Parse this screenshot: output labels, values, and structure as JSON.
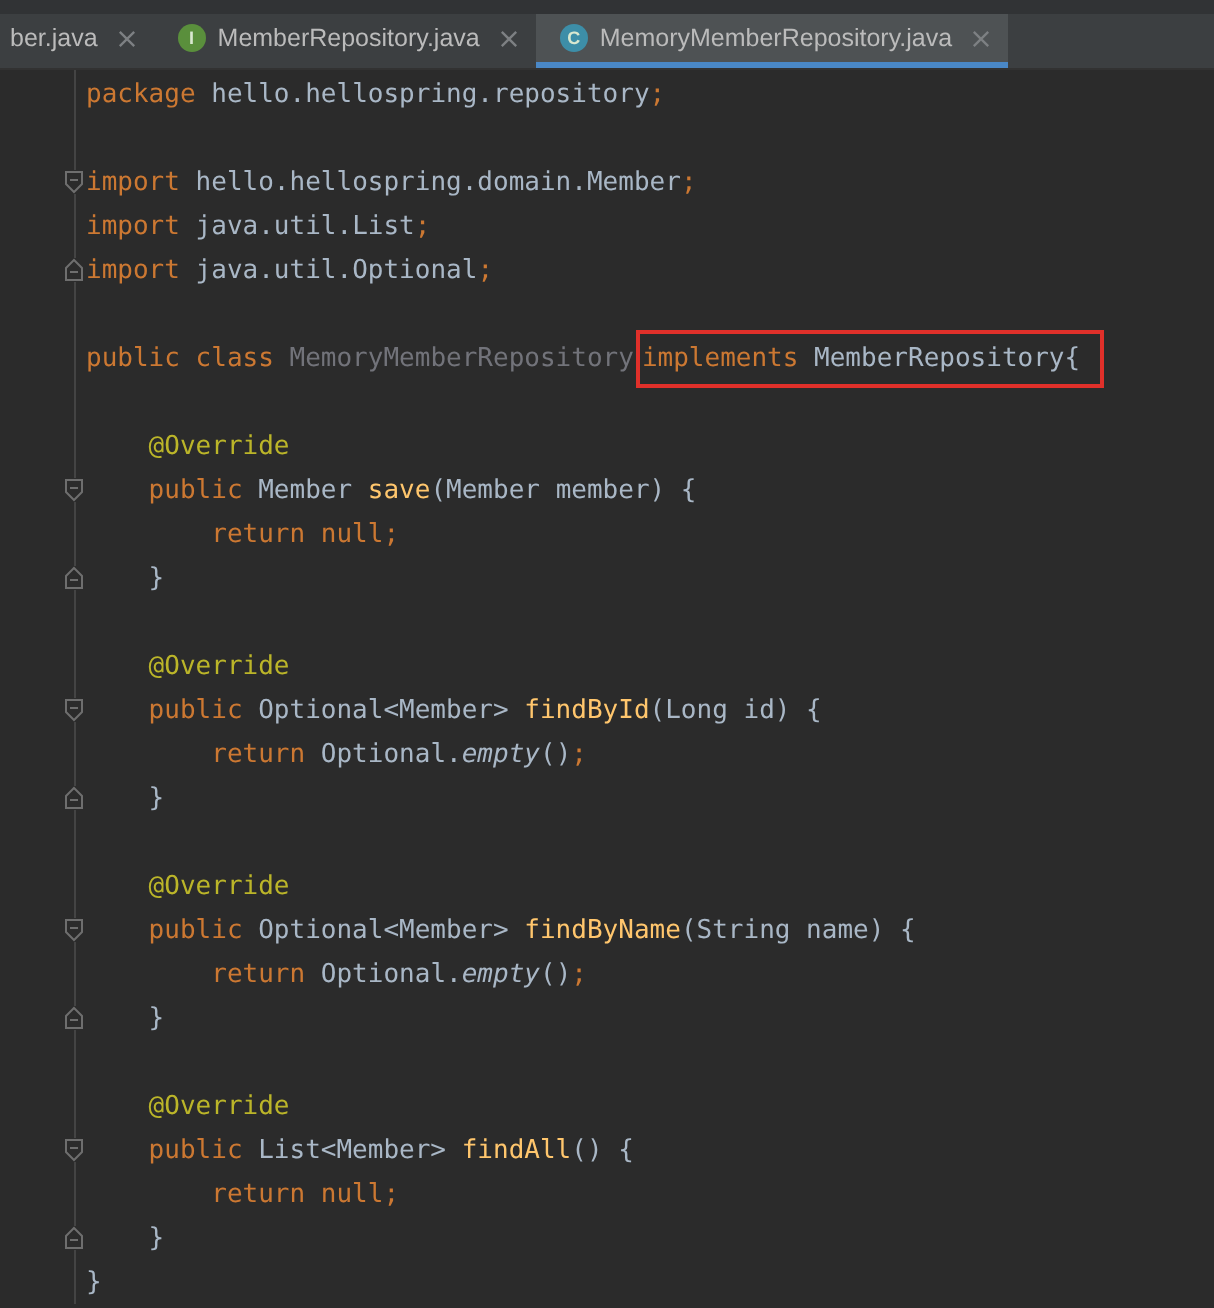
{
  "tabs": [
    {
      "label": "ber.java",
      "selected": false
    },
    {
      "label": "MemberRepository.java",
      "selected": false,
      "icon_letter": "I",
      "color": "#5a8f3c"
    },
    {
      "label": "MemoryMemberRepository.java",
      "selected": true,
      "icon_letter": "C",
      "color": "#3d8ea8"
    }
  ],
  "code_lines": [
    {
      "kind": "plain",
      "tokens": [
        {
          "kind": "keyword",
          "text": "package "
        },
        {
          "kind": "plain",
          "text": "hello.hellospring.repository"
        },
        {
          "kind": "keyword",
          "text": ";"
        }
      ]
    },
    {
      "kind": "blank"
    },
    {
      "kind": "fold_start",
      "tokens": [
        {
          "kind": "keyword",
          "text": "import "
        },
        {
          "kind": "plain",
          "text": "hello.hellospring.domain.Member"
        },
        {
          "kind": "keyword",
          "text": ";"
        }
      ]
    },
    {
      "kind": "plain",
      "tokens": [
        {
          "kind": "keyword",
          "text": "import "
        },
        {
          "kind": "plain",
          "text": "java.util.List"
        },
        {
          "kind": "keyword",
          "text": ";"
        }
      ]
    },
    {
      "kind": "fold_end",
      "tokens": [
        {
          "kind": "keyword",
          "text": "import "
        },
        {
          "kind": "plain",
          "text": "java.util.Optional"
        },
        {
          "kind": "keyword",
          "text": ";"
        }
      ]
    },
    {
      "kind": "blank"
    },
    {
      "kind": "plain",
      "segments": [
        {
          "highlighted": false,
          "tokens": [
            {
              "kind": "keyword",
              "text": "public class "
            },
            {
              "kind": "unused",
              "text": "MemoryMemberRepository"
            }
          ]
        },
        {
          "highlighted": true,
          "tokens": [
            {
              "kind": "keyword",
              "text": "implements "
            },
            {
              "kind": "plain",
              "text": "MemberRepository{"
            }
          ]
        }
      ]
    },
    {
      "kind": "blank"
    },
    {
      "kind": "plain",
      "tokens": [
        {
          "kind": "annotation",
          "text": "    @Override"
        }
      ]
    },
    {
      "kind": "fold_start",
      "tokens": [
        {
          "kind": "keyword",
          "text": "    public "
        },
        {
          "kind": "plain",
          "text": "Member "
        },
        {
          "kind": "method",
          "text": "save"
        },
        {
          "kind": "plain",
          "text": "(Member member) {"
        }
      ]
    },
    {
      "kind": "plain",
      "tokens": [
        {
          "kind": "keyword",
          "text": "        return null;"
        }
      ]
    },
    {
      "kind": "fold_end",
      "tokens": [
        {
          "kind": "plain",
          "text": "    }"
        }
      ]
    },
    {
      "kind": "blank"
    },
    {
      "kind": "plain",
      "tokens": [
        {
          "kind": "annotation",
          "text": "    @Override"
        }
      ]
    },
    {
      "kind": "fold_start",
      "tokens": [
        {
          "kind": "keyword",
          "text": "    public "
        },
        {
          "kind": "plain",
          "text": "Optional<Member> "
        },
        {
          "kind": "method",
          "text": "findById"
        },
        {
          "kind": "plain",
          "text": "(Long id) {"
        }
      ]
    },
    {
      "kind": "plain",
      "tokens": [
        {
          "kind": "keyword",
          "text": "        return "
        },
        {
          "kind": "plain",
          "text": "Optional."
        },
        {
          "kind": "static",
          "text": "empty"
        },
        {
          "kind": "plain",
          "text": "()"
        },
        {
          "kind": "keyword",
          "text": ";"
        }
      ]
    },
    {
      "kind": "fold_end",
      "tokens": [
        {
          "kind": "plain",
          "text": "    }"
        }
      ]
    },
    {
      "kind": "blank"
    },
    {
      "kind": "plain",
      "tokens": [
        {
          "kind": "annotation",
          "text": "    @Override"
        }
      ]
    },
    {
      "kind": "fold_start",
      "tokens": [
        {
          "kind": "keyword",
          "text": "    public "
        },
        {
          "kind": "plain",
          "text": "Optional<Member> "
        },
        {
          "kind": "method",
          "text": "findByName"
        },
        {
          "kind": "plain",
          "text": "(String name) {"
        }
      ]
    },
    {
      "kind": "plain",
      "tokens": [
        {
          "kind": "keyword",
          "text": "        return "
        },
        {
          "kind": "plain",
          "text": "Optional."
        },
        {
          "kind": "static",
          "text": "empty"
        },
        {
          "kind": "plain",
          "text": "()"
        },
        {
          "kind": "keyword",
          "text": ";"
        }
      ]
    },
    {
      "kind": "fold_end",
      "tokens": [
        {
          "kind": "plain",
          "text": "    }"
        }
      ]
    },
    {
      "kind": "blank"
    },
    {
      "kind": "plain",
      "tokens": [
        {
          "kind": "annotation",
          "text": "    @Override"
        }
      ]
    },
    {
      "kind": "fold_start",
      "tokens": [
        {
          "kind": "keyword",
          "text": "    public "
        },
        {
          "kind": "plain",
          "text": "List<Member> "
        },
        {
          "kind": "method",
          "text": "findAll"
        },
        {
          "kind": "plain",
          "text": "() {"
        }
      ]
    },
    {
      "kind": "plain",
      "tokens": [
        {
          "kind": "keyword",
          "text": "        return null;"
        }
      ]
    },
    {
      "kind": "fold_end",
      "tokens": [
        {
          "kind": "plain",
          "text": "    }"
        }
      ]
    },
    {
      "kind": "plain",
      "tokens": [
        {
          "kind": "plain",
          "text": "}"
        }
      ]
    }
  ]
}
